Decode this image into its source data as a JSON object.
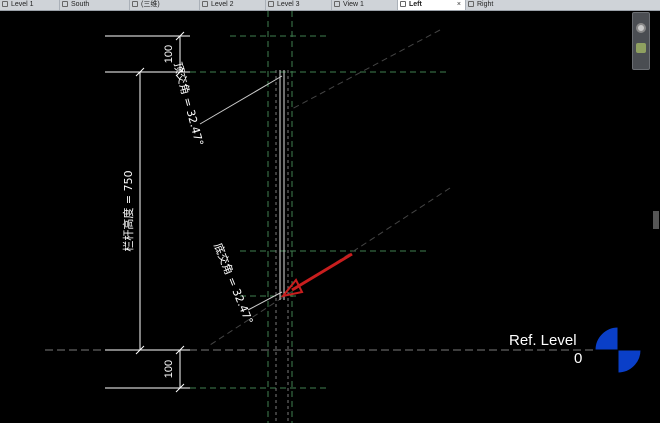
{
  "tabs": [
    {
      "label": "Level 1",
      "active": false
    },
    {
      "label": "South",
      "active": false
    },
    {
      "label": "(三维)",
      "active": false
    },
    {
      "label": "Level 2",
      "active": false
    },
    {
      "label": "Level 3",
      "active": false
    },
    {
      "label": "View 1",
      "active": false
    },
    {
      "label": "Left",
      "active": true
    },
    {
      "label": "Right",
      "active": false
    }
  ],
  "close_glyph": "×",
  "annotations": {
    "dim_top": "100",
    "dim_bottom": "100",
    "rail_height": "栏杆高度 = 750",
    "top_angle": "顶交角 = 32.47°",
    "bottom_angle": "底交角 = 32.47°"
  },
  "level": {
    "name": "Ref. Level",
    "elevation": "0"
  },
  "colors": {
    "background": "#000000",
    "dim_line": "#ffffff",
    "guide_dashed": "#3f7f4f",
    "arrow": "#c81e1e",
    "level_marker": "#0a3fc8"
  },
  "icons": {
    "navigation_wheel": "steering-wheel-icon",
    "zoom": "zoom-icon"
  }
}
